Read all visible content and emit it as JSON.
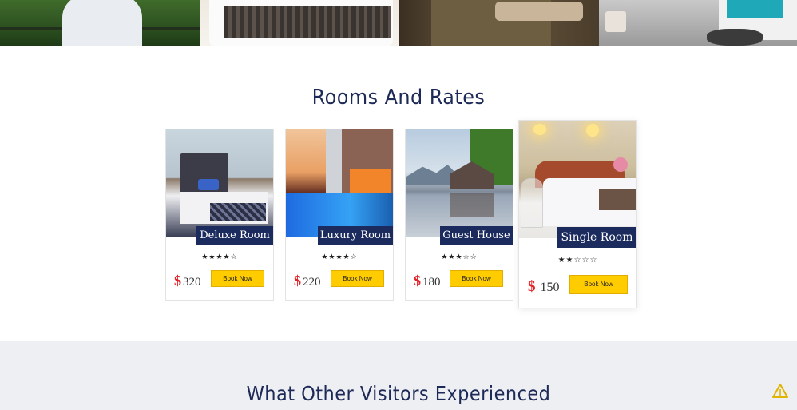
{
  "banner": {
    "images": [
      "woman-on-balcony",
      "bed-with-patterned-runner",
      "brown-bedding-room",
      "modern-living-room"
    ]
  },
  "rooms_section": {
    "title": "Rooms And Rates",
    "rooms": [
      {
        "name": "Deluxe Room",
        "rating": 4,
        "max_rating": 5,
        "stars_text": "★★★★☆",
        "currency": "$",
        "price": "320",
        "book_label": "Book Now"
      },
      {
        "name": "Luxury Room",
        "rating": 4,
        "max_rating": 5,
        "stars_text": "★★★★☆",
        "currency": "$",
        "price": "220",
        "book_label": "Book Now"
      },
      {
        "name": "Guest House",
        "rating": 3,
        "max_rating": 5,
        "stars_text": "★★★☆☆",
        "currency": "$",
        "price": "180",
        "book_label": "Book Now"
      },
      {
        "name": "Single Room",
        "rating": 2,
        "max_rating": 5,
        "stars_text": "★★☆☆☆",
        "currency": "$",
        "price": "150",
        "book_label": "Book Now"
      }
    ]
  },
  "testimonials_section": {
    "title": "What Other Visitors Experienced"
  },
  "scroll_top_icon": "triangle-up-icon",
  "colors": {
    "navy": "#1b2b5e",
    "title_navy": "#1d2a57",
    "button_yellow": "#ffcc00",
    "currency_red": "#e32227",
    "band_grey": "#eeeff2"
  }
}
